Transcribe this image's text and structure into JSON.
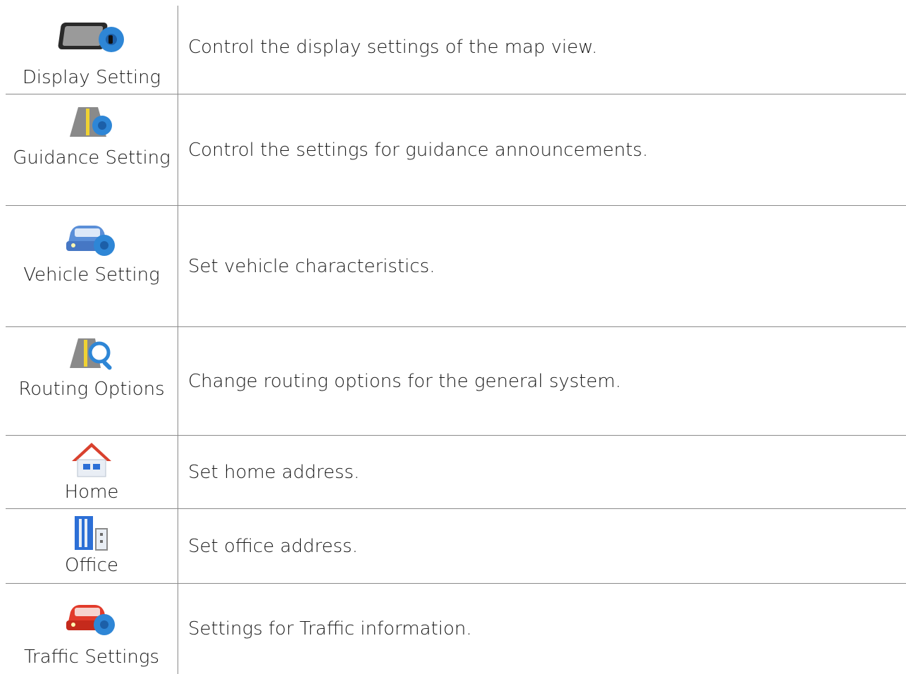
{
  "rows": [
    {
      "label": "Display Setting",
      "icon": "display-gear-icon",
      "desc": "Control the display settings of the map view."
    },
    {
      "label": "Guidance Setting",
      "icon": "road-gear-icon",
      "desc": "Control the settings for guidance announcements."
    },
    {
      "label": "Vehicle Setting",
      "icon": "car-gear-icon",
      "desc": "Set vehicle characteristics."
    },
    {
      "label": "Routing Options",
      "icon": "road-magnifier-icon",
      "desc": "Change routing options for the general system."
    },
    {
      "label": "Home",
      "icon": "home-icon",
      "desc": "Set home address."
    },
    {
      "label": "Office",
      "icon": "office-building-icon",
      "desc": "Set office address."
    },
    {
      "label": "Traffic Settings",
      "icon": "traffic-car-gear-icon",
      "desc": "Settings for Traffic information."
    }
  ],
  "colors": {
    "gear": "#2e86d6",
    "car_blue": "#5a8fd8",
    "car_red": "#e23b2b",
    "roof_red": "#d9412e",
    "building_blue": "#2c6fd6"
  }
}
